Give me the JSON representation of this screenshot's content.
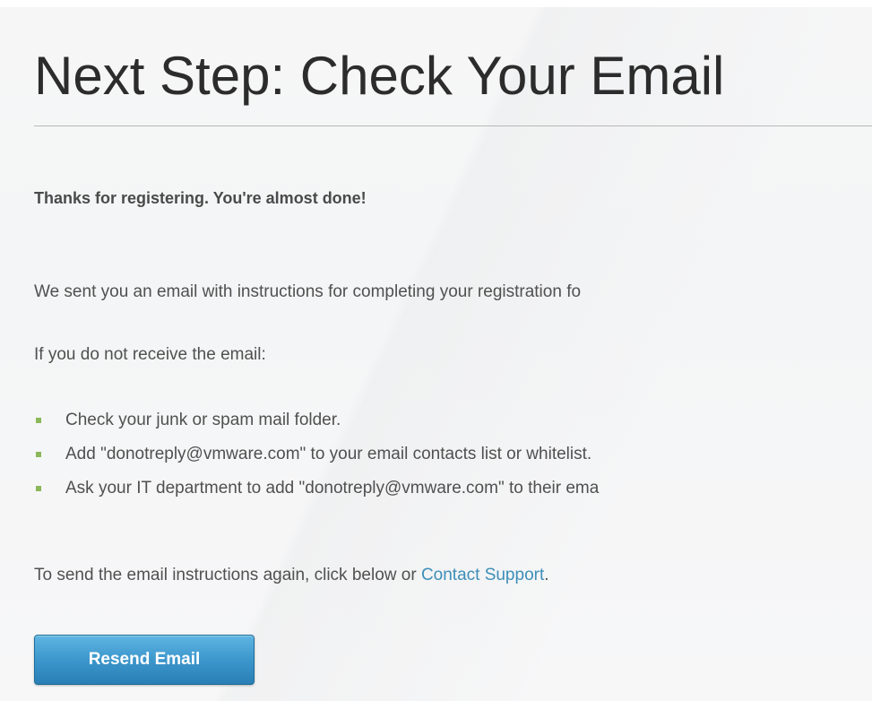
{
  "page": {
    "title": "Next Step: Check Your Email",
    "lead": "Thanks for registering. You're almost done!",
    "sent_text": "We sent you an email with instructions for completing your registration fo",
    "not_received_text": "If you do not receive the email:",
    "bullets": [
      "Check your junk or spam mail folder.",
      "Add \"donotreply@vmware.com\" to your email contacts list or whitelist.",
      "Ask your IT department to add \"donotreply@vmware.com\" to their ema"
    ],
    "resend_prefix": "To send the email instructions again, click below or ",
    "support_link": "Contact Support",
    "resend_suffix": ".",
    "resend_button": "Resend Email"
  },
  "colors": {
    "title": "#2c2c2c",
    "text": "#505050",
    "link": "#3d8eb8",
    "bullet": "#8ab85a",
    "button": "#3c97cc"
  }
}
